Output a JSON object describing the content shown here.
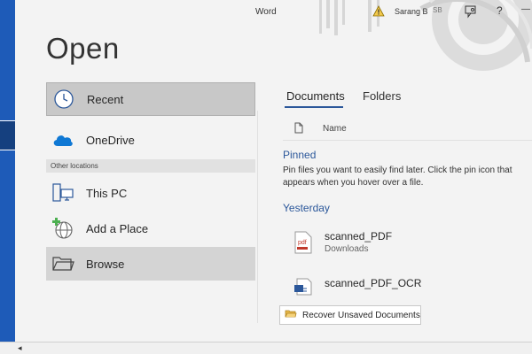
{
  "titlebar": {
    "app_name": "Word",
    "user_name": "Sarang B",
    "user_initials": "SB",
    "help": "?",
    "warning_icon": "warning-icon",
    "feedback_icon": "feedback-icon"
  },
  "page": {
    "title": "Open"
  },
  "locations": {
    "recent": "Recent",
    "onedrive": "OneDrive",
    "other_header": "Other locations",
    "this_pc": "This PC",
    "add_place": "Add a Place",
    "browse": "Browse"
  },
  "tabs": {
    "documents": "Documents",
    "folders": "Folders"
  },
  "columns": {
    "name": "Name"
  },
  "pinned": {
    "header": "Pinned",
    "message": "Pin files you want to easily find later. Click the pin icon that appears when you hover over a file."
  },
  "yesterday": {
    "header": "Yesterday",
    "files": [
      {
        "name": "scanned_PDF",
        "location": "Downloads",
        "icon": "pdf-file-icon"
      },
      {
        "name": "scanned_PDF_OCR",
        "location": "",
        "icon": "word-file-icon"
      }
    ]
  },
  "recover": {
    "label": "Recover Unsaved Documents"
  },
  "colors": {
    "accent": "#2b579a",
    "rail": "#1e5bb8",
    "selected_bg": "#c8c8c8"
  }
}
